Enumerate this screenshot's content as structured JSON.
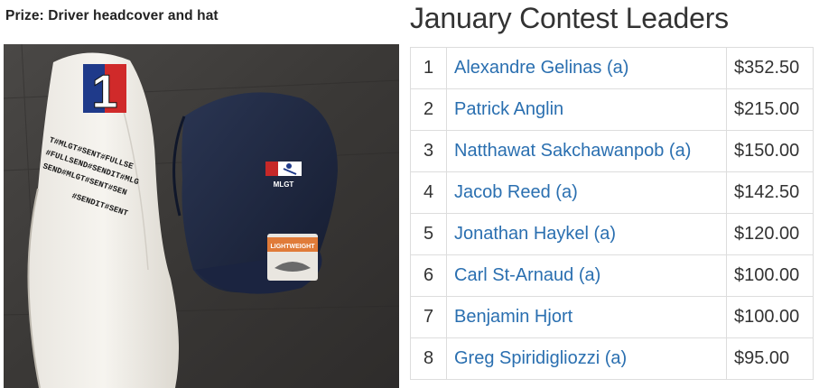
{
  "prize": {
    "title": "Prize: Driver headcover and hat"
  },
  "photo": {
    "headcover_number": "1",
    "headcover_text": [
      "T#MLGT#SENT#FULLSE",
      "#FULLSEND#SENDIT#MLG",
      "SEND#MLGT#SENT#SEN",
      "#SENDIT#SENT"
    ],
    "hat_logo_text": "MLGT",
    "tag_text": "LIGHTWEIGHT"
  },
  "leaders": {
    "title": "January Contest Leaders",
    "rows": [
      {
        "rank": "1",
        "name": "Alexandre Gelinas (a)",
        "amount": "$352.50"
      },
      {
        "rank": "2",
        "name": "Patrick Anglin",
        "amount": "$215.00"
      },
      {
        "rank": "3",
        "name": "Natthawat Sakchawanpob (a)",
        "amount": "$150.00"
      },
      {
        "rank": "4",
        "name": "Jacob Reed (a)",
        "amount": "$142.50"
      },
      {
        "rank": "5",
        "name": "Jonathan Haykel (a)",
        "amount": "$120.00"
      },
      {
        "rank": "6",
        "name": "Carl St-Arnaud (a)",
        "amount": "$100.00"
      },
      {
        "rank": "7",
        "name": "Benjamin Hjort",
        "amount": "$100.00"
      },
      {
        "rank": "8",
        "name": "Greg Spiridigliozzi (a)",
        "amount": "$95.00"
      }
    ]
  }
}
